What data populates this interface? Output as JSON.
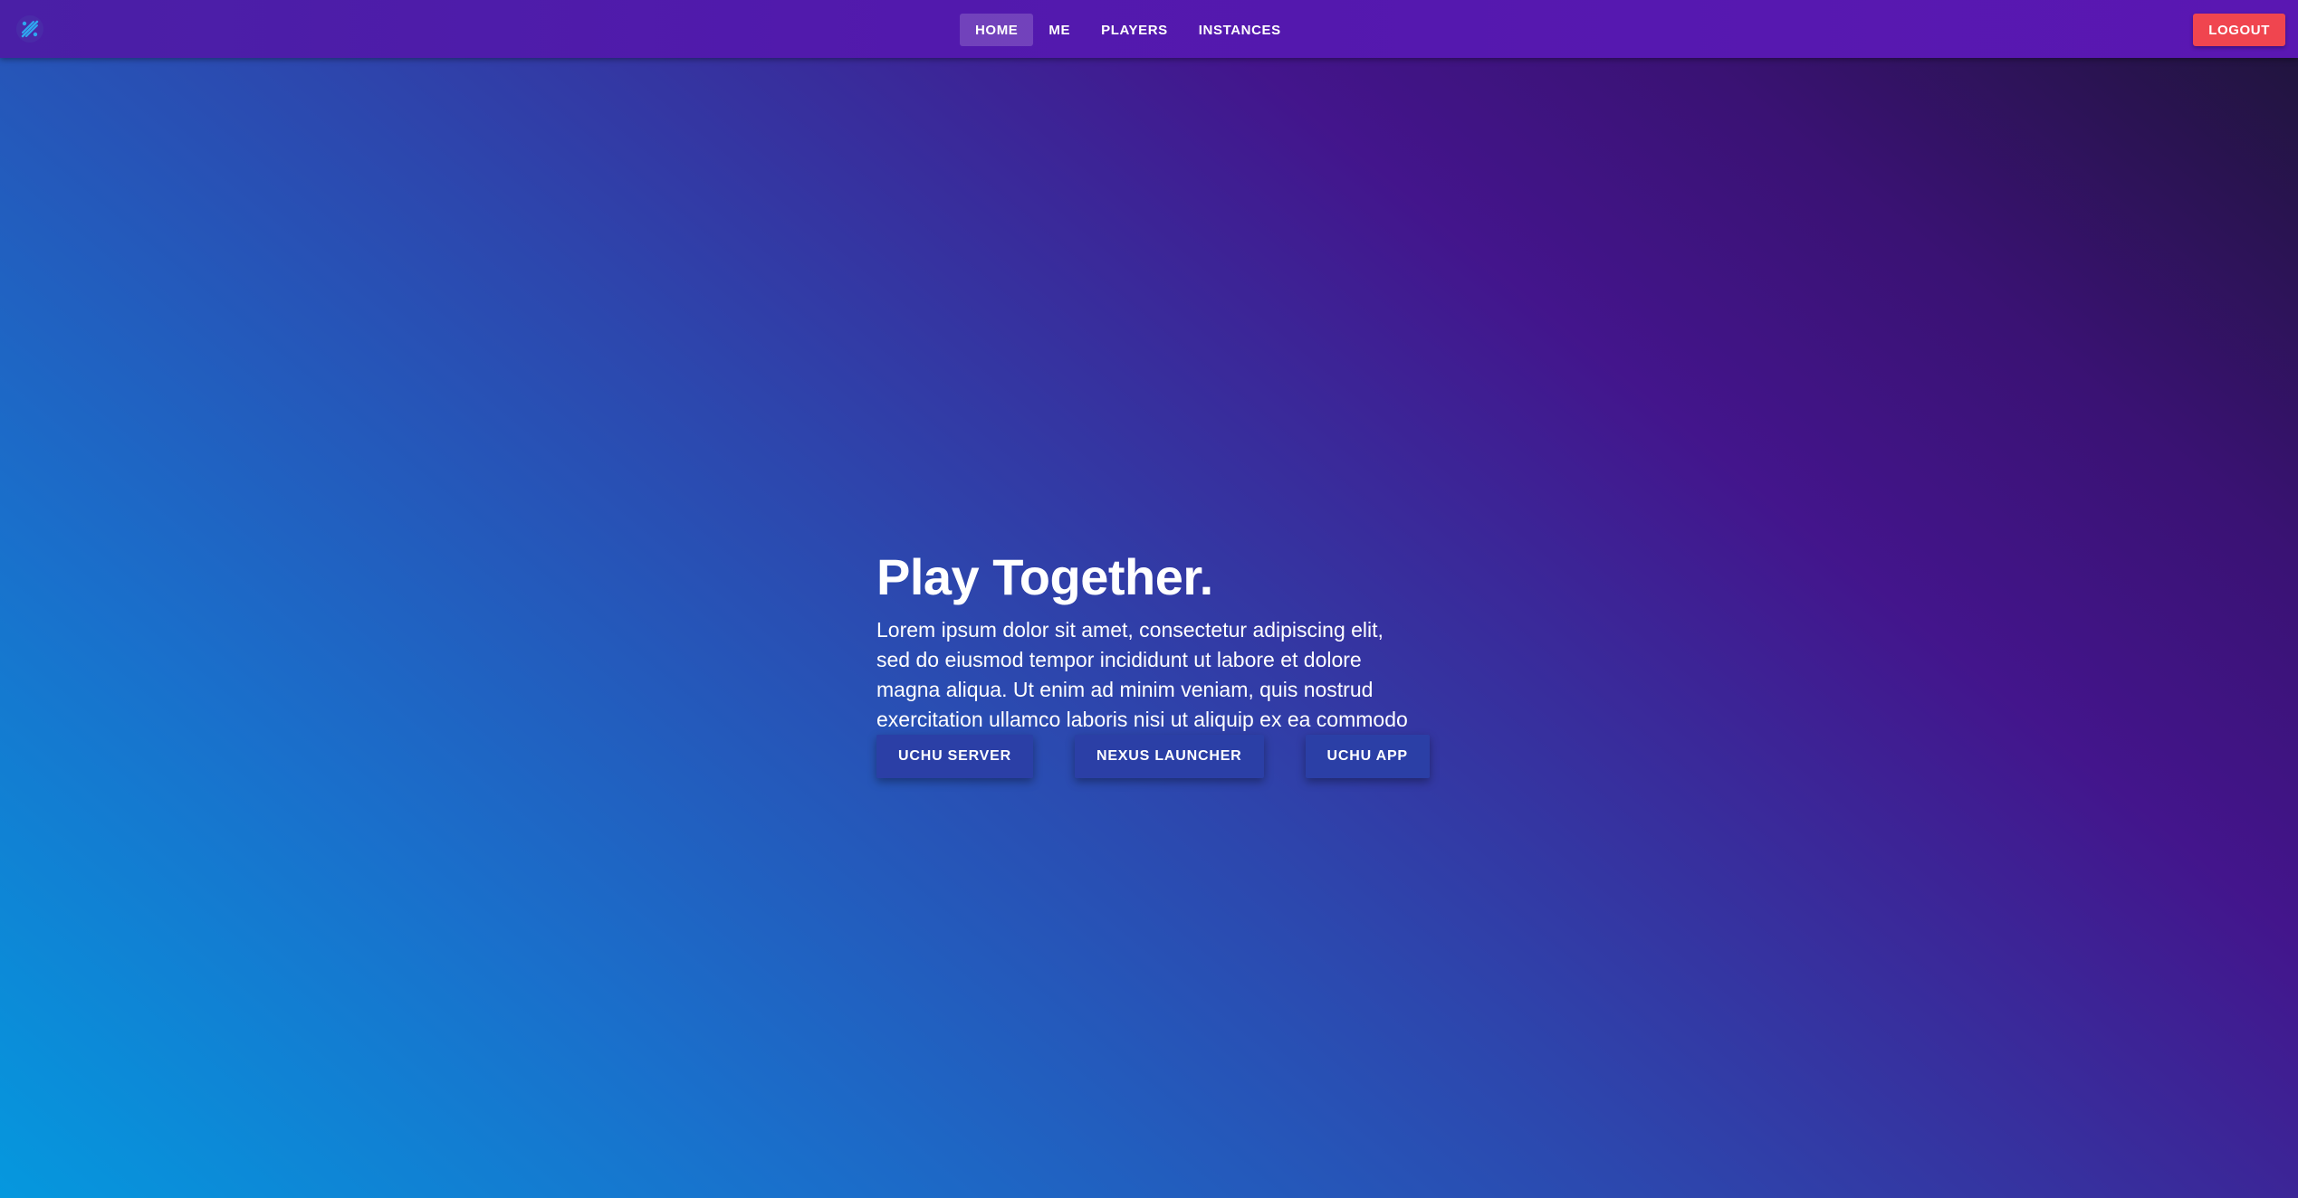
{
  "navbar": {
    "logo_icon": "logo-icon",
    "links": [
      {
        "label": "HOME",
        "active": true
      },
      {
        "label": "ME",
        "active": false
      },
      {
        "label": "PLAYERS",
        "active": false
      },
      {
        "label": "INSTANCES",
        "active": false
      }
    ],
    "logout_label": "LOGOUT"
  },
  "hero": {
    "title": "Play Together.",
    "text": "Lorem ipsum dolor sit amet, consectetur adipiscing elit, sed do eiusmod tempor incididunt ut labore et dolore magna aliqua. Ut enim ad minim veniam, quis nostrud exercitation ullamco laboris nisi ut aliquip ex ea commodo consequat..",
    "buttons": [
      {
        "label": "UCHU SERVER"
      },
      {
        "label": "NEXUS LAUNCHER"
      },
      {
        "label": "UCHU APP"
      }
    ]
  },
  "colors": {
    "navbar": "#5219ad",
    "logout": "#f0454f",
    "hero_button": "#2b3fa6",
    "gradient_start": "#0598de",
    "gradient_end": "#1e1438"
  }
}
